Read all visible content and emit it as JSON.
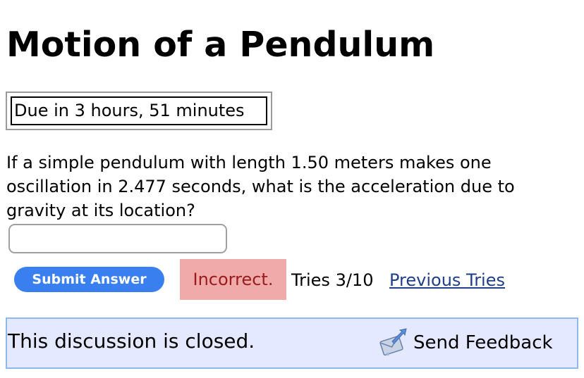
{
  "page": {
    "title": "Motion of a Pendulum"
  },
  "due": {
    "text": "Due in 3 hours, 51 minutes"
  },
  "problem": {
    "question": "If a simple pendulum with length 1.50 meters makes one oscillation in 2.477 seconds, what is the acceleration due to gravity at its location?",
    "answer_value": "",
    "answer_placeholder": ""
  },
  "actions": {
    "submit_label": "Submit Answer",
    "status_label": "Incorrect.",
    "tries_text": "Tries 3/10",
    "previous_tries_label": "Previous Tries"
  },
  "discussion": {
    "closed_text": "This discussion is closed.",
    "feedback_label": "Send Feedback",
    "feedback_icon": "send-feedback-icon"
  },
  "colors": {
    "submit_button": "#3a7fef",
    "incorrect_bg": "#f0aaaa",
    "incorrect_text": "#9b1b1b",
    "link": "#1f3f8a",
    "discussion_bg": "#e5e9ff",
    "discussion_border": "#8db8f0"
  }
}
